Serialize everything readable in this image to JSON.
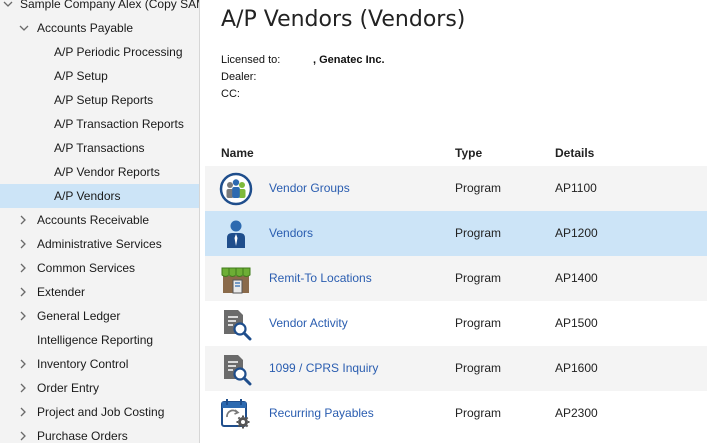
{
  "sidebar": {
    "items": [
      {
        "label": "Sample Company Alex (Copy SAM",
        "expanded": true
      },
      {
        "label": "Accounts Payable",
        "expanded": true
      },
      {
        "label": "A/P Periodic Processing"
      },
      {
        "label": "A/P Setup"
      },
      {
        "label": "A/P Setup Reports"
      },
      {
        "label": "A/P Transaction Reports"
      },
      {
        "label": "A/P Transactions"
      },
      {
        "label": "A/P Vendor Reports"
      },
      {
        "label": "A/P Vendors",
        "selected": true
      },
      {
        "label": "Accounts Receivable",
        "expanded": false
      },
      {
        "label": "Administrative Services",
        "expanded": false
      },
      {
        "label": "Common Services",
        "expanded": false
      },
      {
        "label": "Extender",
        "expanded": false
      },
      {
        "label": "General Ledger",
        "expanded": false
      },
      {
        "label": "Intelligence Reporting"
      },
      {
        "label": "Inventory Control",
        "expanded": false
      },
      {
        "label": "Order Entry",
        "expanded": false
      },
      {
        "label": "Project and Job Costing",
        "expanded": false
      },
      {
        "label": "Purchase Orders",
        "expanded": false
      }
    ]
  },
  "main": {
    "title": "A/P Vendors (Vendors)",
    "licensed_to_label": "Licensed to:",
    "licensed_to_value": ", Genatec Inc.",
    "dealer_label": "Dealer:",
    "dealer_value": "",
    "cc_label": "CC:",
    "cc_value": "",
    "columns": {
      "name": "Name",
      "type": "Type",
      "details": "Details"
    },
    "rows": [
      {
        "name": "Vendor Groups",
        "type": "Program",
        "details": "AP1100",
        "icon": "vendor-groups-icon"
      },
      {
        "name": "Vendors",
        "type": "Program",
        "details": "AP1200",
        "icon": "vendor-person-icon",
        "selected": true
      },
      {
        "name": "Remit-To Locations",
        "type": "Program",
        "details": "AP1400",
        "icon": "storefront-icon"
      },
      {
        "name": "Vendor Activity",
        "type": "Program",
        "details": "AP1500",
        "icon": "document-search-icon"
      },
      {
        "name": "1099 / CPRS Inquiry",
        "type": "Program",
        "details": "AP1600",
        "icon": "document-search-icon"
      },
      {
        "name": "Recurring Payables",
        "type": "Program",
        "details": "AP2300",
        "icon": "calendar-gear-icon"
      }
    ]
  },
  "colors": {
    "selection": "#cce4f7",
    "link": "#2a5db0",
    "sidebar_bg": "#f3f3f3"
  }
}
